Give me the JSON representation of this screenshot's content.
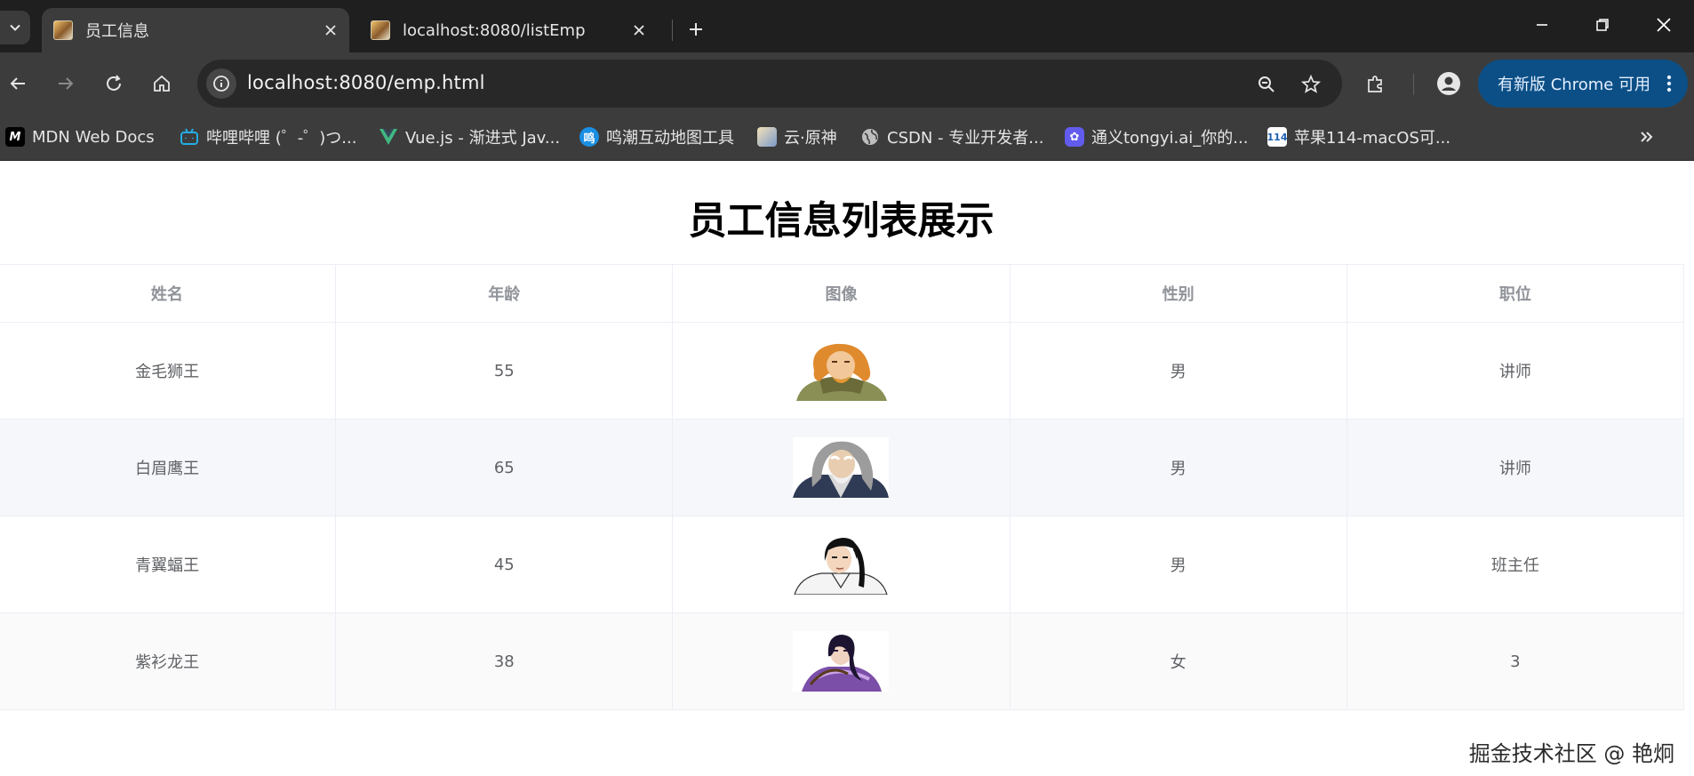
{
  "browser": {
    "tabs": [
      {
        "title": "员工信息",
        "active": true
      },
      {
        "title": "localhost:8080/listEmp",
        "active": false
      }
    ],
    "address_url": "localhost:8080/emp.html",
    "update_button_label": "有新版 Chrome 可用",
    "bookmarks": [
      {
        "label": "MDN Web Docs",
        "icon": "mdn-icon"
      },
      {
        "label": "哔哩哔哩 (゜-゜)つ...",
        "icon": "bilibili-icon"
      },
      {
        "label": "Vue.js - 渐进式 Jav...",
        "icon": "vue-icon"
      },
      {
        "label": "鸣潮互动地图工具",
        "icon": "wuthering-map-icon"
      },
      {
        "label": "云·原神",
        "icon": "genshin-cloud-icon"
      },
      {
        "label": "CSDN - 专业开发者...",
        "icon": "globe-icon"
      },
      {
        "label": "通义tongyi.ai_你的...",
        "icon": "tongyi-icon"
      },
      {
        "label": "苹果114-macOS可...",
        "icon": "apple114-icon"
      }
    ]
  },
  "page": {
    "title": "员工信息列表展示",
    "table": {
      "headers": [
        "姓名",
        "年龄",
        "图像",
        "性别",
        "职位"
      ],
      "rows": [
        {
          "name": "金毛狮王",
          "age": "55",
          "avatar": "golden-lion-king-avatar",
          "gender": "男",
          "job": "讲师"
        },
        {
          "name": "白眉鹰王",
          "age": "65",
          "avatar": "white-brow-eagle-king-avatar",
          "gender": "男",
          "job": "讲师"
        },
        {
          "name": "青翼蝠王",
          "age": "45",
          "avatar": "green-wing-bat-king-avatar",
          "gender": "男",
          "job": "班主任"
        },
        {
          "name": "紫衫龙王",
          "age": "38",
          "avatar": "purple-robe-dragon-king-avatar",
          "gender": "女",
          "job": "3"
        }
      ]
    }
  },
  "watermark": "掘金技术社区 @ 艳炯",
  "colors": {
    "tabstrip_bg": "#1f1f1f",
    "toolbar_bg": "#3c3c3c",
    "update_button_bg": "#0b4f86",
    "table_header_text": "#909399",
    "table_cell_text": "#606266",
    "table_border": "#ebeef5",
    "striped_row_bg": "#f5f7fa"
  }
}
